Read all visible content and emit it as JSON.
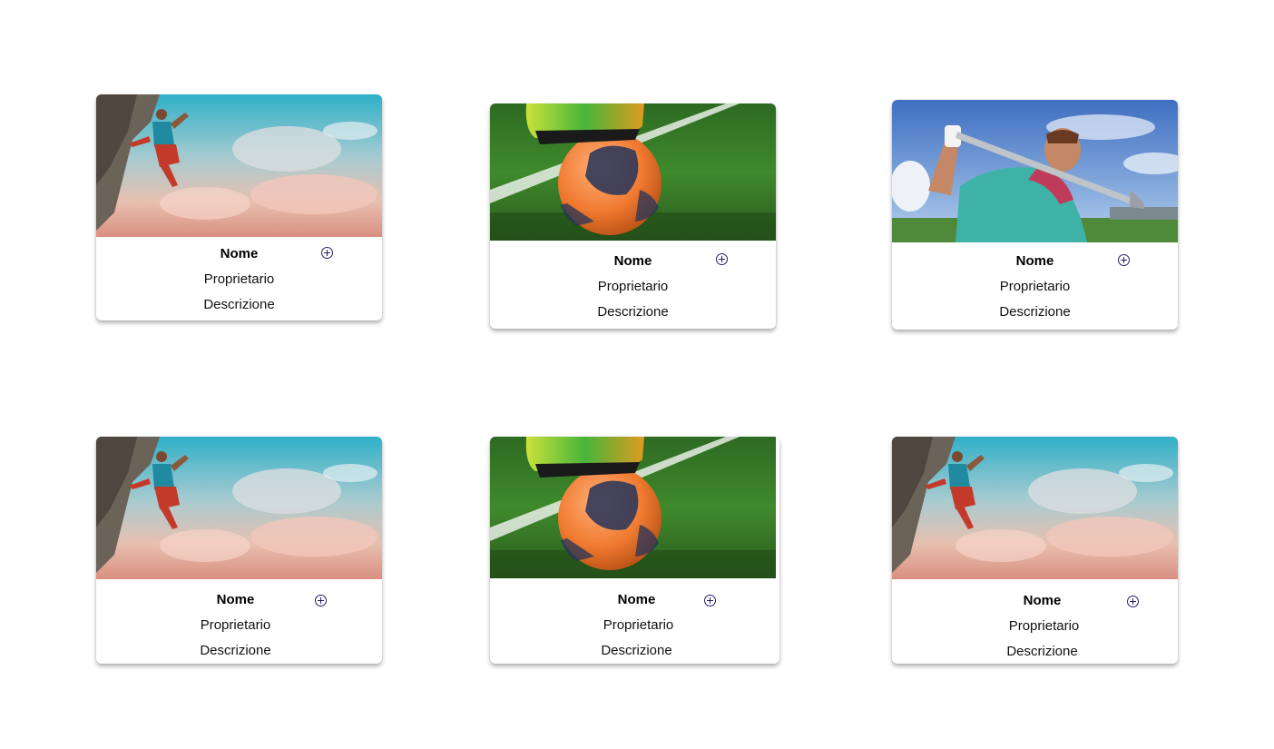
{
  "cards": [
    {
      "image_icon": "rock-climbing-photo",
      "name": "Nome",
      "owner": "Proprietario",
      "description": "Descrizione",
      "add_icon": "plus-circle-icon"
    },
    {
      "image_icon": "soccer-ball-photo",
      "name": "Nome",
      "owner": "Proprietario",
      "description": "Descrizione",
      "add_icon": "plus-circle-icon"
    },
    {
      "image_icon": "golf-swing-photo",
      "name": "Nome",
      "owner": "Proprietario",
      "description": "Descrizione",
      "add_icon": "plus-circle-icon"
    },
    {
      "image_icon": "rock-climbing-photo",
      "name": "Nome",
      "owner": "Proprietario",
      "description": "Descrizione",
      "add_icon": "plus-circle-icon"
    },
    {
      "image_icon": "soccer-ball-photo",
      "name": "Nome",
      "owner": "Proprietario",
      "description": "Descrizione",
      "add_icon": "plus-circle-icon"
    },
    {
      "image_icon": "rock-climbing-photo",
      "name": "Nome",
      "owner": "Proprietario",
      "description": "Descrizione",
      "add_icon": "plus-circle-icon"
    }
  ],
  "colors": {
    "add_icon": "#2a1a6e",
    "card_background": "#ffffff"
  }
}
